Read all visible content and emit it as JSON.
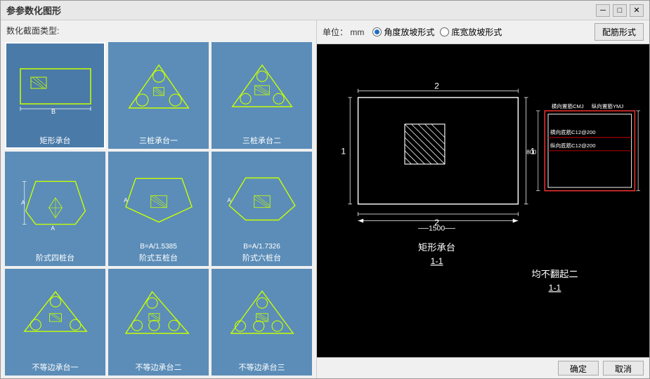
{
  "window": {
    "title": "参参数化图形",
    "minimize": "─",
    "maximize": "□",
    "close": "✕"
  },
  "left": {
    "section_label": "数化截面类型:",
    "shapes": [
      {
        "id": "juxing",
        "label": "矩形承台",
        "selected": true
      },
      {
        "id": "sanzhu1",
        "label": "三桩承台一",
        "selected": false
      },
      {
        "id": "sanzhu2",
        "label": "三桩承台二",
        "selected": false
      },
      {
        "id": "jie4",
        "label": "阶式四桩台",
        "selected": false
      },
      {
        "id": "jie5",
        "label": "阶式五桩台",
        "selected": false
      },
      {
        "id": "jie6",
        "label": "阶式六桩台",
        "selected": false
      },
      {
        "id": "budeng1",
        "label": "不等边承台一",
        "selected": false
      },
      {
        "id": "budeng2",
        "label": "不等边承台二",
        "selected": false
      },
      {
        "id": "budeng3",
        "label": "不等边承台三",
        "selected": false
      }
    ],
    "shape_formulas": {
      "jie5": "B=A/1.5385",
      "jie6": "B=A/1.7326"
    }
  },
  "top_bar": {
    "unit_label": "单位：",
    "unit_value": "mm",
    "radio_options": [
      {
        "label": "角度放坡形式",
        "selected": true
      },
      {
        "label": "底宽放坡形式",
        "selected": false
      }
    ],
    "config_btn": "配筋形式"
  },
  "bottom_bar": {
    "confirm_btn": "确定",
    "cancel_btn": "取消"
  },
  "cad": {
    "main_drawing": {
      "title": "矩形承台",
      "section": "1-1",
      "note": "均不翻起二",
      "dim_top": "2",
      "dim_bottom": "2",
      "dim_left": "1",
      "dim_right": "1",
      "dim_width": "1500",
      "dim_height": "800"
    },
    "detail": {
      "labels": [
        "横向置筋CMJ",
        "纵向置筋YMJ",
        "横向底筋C128200",
        "纵向底筋C12@200"
      ]
    }
  }
}
